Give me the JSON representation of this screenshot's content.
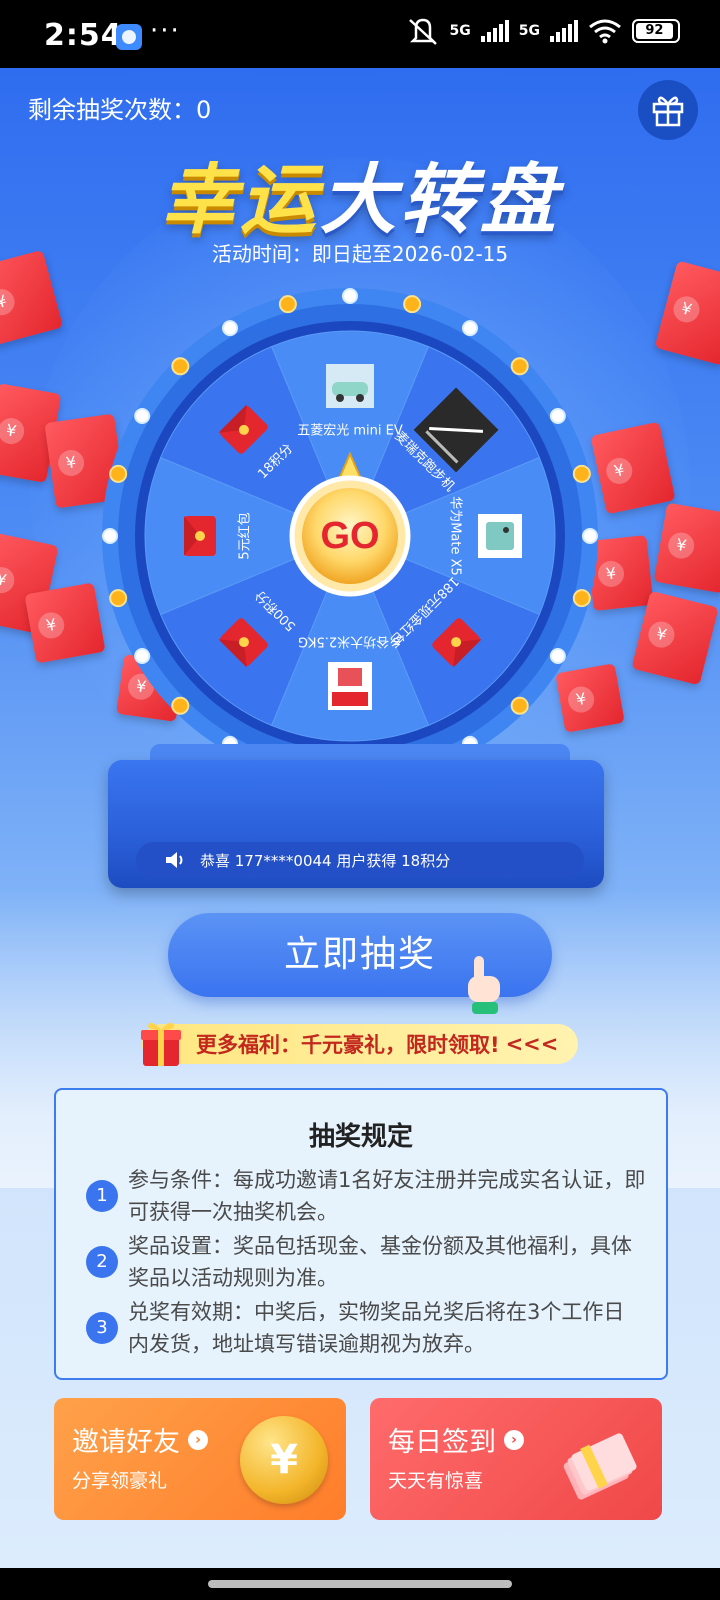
{
  "status_bar": {
    "time": "2:54",
    "dots": "···",
    "network1": "5G",
    "network2": "5G",
    "battery": "92"
  },
  "header": {
    "remaining_label": "剩余抽奖次数：0",
    "title_part1": "幸运",
    "title_part2": "大转盘",
    "period": "活动时间：即日起至2026-02-15"
  },
  "wheel": {
    "center_label": "GO",
    "prizes": [
      {
        "label": "五菱宏光 mini EV",
        "icon": "car-icon"
      },
      {
        "label": "麦瑞克跑步机",
        "icon": "treadmill-icon"
      },
      {
        "label": "华为Mate X5",
        "icon": "phone-icon"
      },
      {
        "label": "188元现金红包",
        "icon": "red-envelope-icon"
      },
      {
        "label": "乡谷坊大米2.5KG",
        "icon": "rice-bag-icon"
      },
      {
        "label": "500积分",
        "icon": "red-envelope-icon"
      },
      {
        "label": "5元红包",
        "icon": "red-envelope-icon"
      },
      {
        "label": "18积分",
        "icon": "red-envelope-icon"
      }
    ]
  },
  "ticker": {
    "text": "恭喜 177****0044 用户获得 18积分"
  },
  "draw_button": {
    "label": "立即抽奖"
  },
  "welfare": {
    "text": "更多福利：千元豪礼，限时领取!",
    "arrows": "<<<"
  },
  "rules": {
    "title": "抽奖规定",
    "items": [
      {
        "num": "1",
        "text": "参与条件：每成功邀请1名好友注册并完成实名认证，即可获得一次抽奖机会。"
      },
      {
        "num": "2",
        "text": "奖品设置：奖品包括现金、基金份额及其他福利，具体奖品以活动规则为准。"
      },
      {
        "num": "3",
        "text": "兑奖有效期：中奖后，实物奖品兑奖后将在3个工作日 内发货，地址填写错误逾期视为放弃。"
      }
    ]
  },
  "cards": {
    "invite": {
      "title": "邀请好友",
      "subtitle": "分享领豪礼",
      "arrow": "›",
      "coin": "¥"
    },
    "checkin": {
      "title": "每日签到",
      "subtitle": "天天有惊喜",
      "arrow": "›"
    }
  },
  "colors": {
    "primary": "#3a74ef",
    "title_yellow": "#ffe24a",
    "red": "#e4262e",
    "orange": "#ff7d2a"
  }
}
